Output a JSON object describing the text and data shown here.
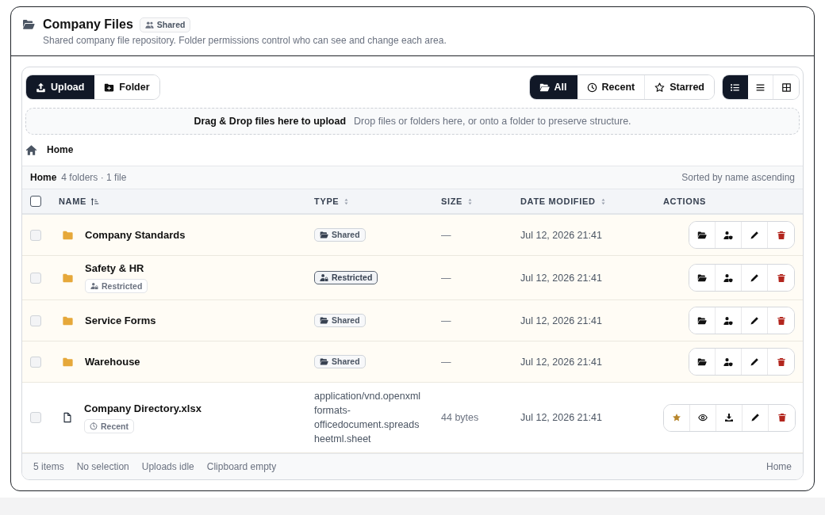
{
  "header": {
    "title": "Company Files",
    "badge": "Shared",
    "description": "Shared company file repository. Folder permissions control who can see and change each area."
  },
  "toolbar": {
    "actions": [
      {
        "kind": "upload",
        "label": "Upload",
        "primary": true
      },
      {
        "kind": "folder",
        "label": "Folder",
        "primary": false
      }
    ],
    "filters": [
      {
        "label": "All",
        "selected": true
      },
      {
        "label": "Recent",
        "selected": false
      },
      {
        "label": "Starred",
        "selected": false
      }
    ],
    "views": [
      {
        "kind": "details",
        "selected": true
      },
      {
        "kind": "list",
        "selected": false
      },
      {
        "kind": "grid",
        "selected": false
      }
    ]
  },
  "dropzone": {
    "title": "Drag & Drop files here to upload",
    "hint": "Drop files or folders here, or onto a folder to preserve structure."
  },
  "breadcrumb": [
    {
      "label": "Home"
    }
  ],
  "summary": {
    "location": "Home",
    "counts": "4 folders · 1 file",
    "sort_note": "Sorted by name ascending"
  },
  "table": {
    "select_all": false,
    "columns": [
      {
        "label": "NAME",
        "sorted": true
      },
      {
        "label": "TYPE",
        "sorted": false
      },
      {
        "label": "SIZE",
        "sorted": false
      },
      {
        "label": "DATE MODIFIED",
        "sorted": false
      },
      {
        "label": "ACTIONS"
      }
    ],
    "rows": [
      {
        "kind": "folder",
        "selected": false,
        "name": "Company Standards",
        "type": {
          "kind": "shared",
          "label": "Shared"
        },
        "size": "—",
        "modified": "Jul 12, 2026 21:41",
        "actions": [
          {
            "kind": "open"
          },
          {
            "kind": "permissions"
          },
          {
            "kind": "rename"
          },
          {
            "kind": "delete"
          }
        ]
      },
      {
        "kind": "folder",
        "selected": false,
        "name": "Safety & HR",
        "tag": {
          "kind": "restricted",
          "label": "Restricted"
        },
        "type": {
          "kind": "restricted",
          "label": "Restricted"
        },
        "size": "—",
        "modified": "Jul 12, 2026 21:41",
        "actions": [
          {
            "kind": "open"
          },
          {
            "kind": "permissions"
          },
          {
            "kind": "rename"
          },
          {
            "kind": "delete"
          }
        ]
      },
      {
        "kind": "folder",
        "selected": false,
        "name": "Service Forms",
        "type": {
          "kind": "shared",
          "label": "Shared"
        },
        "size": "—",
        "modified": "Jul 12, 2026 21:41",
        "actions": [
          {
            "kind": "open"
          },
          {
            "kind": "permissions"
          },
          {
            "kind": "rename"
          },
          {
            "kind": "delete"
          }
        ]
      },
      {
        "kind": "folder",
        "selected": false,
        "name": "Warehouse",
        "type": {
          "kind": "shared",
          "label": "Shared"
        },
        "size": "—",
        "modified": "Jul 12, 2026 21:41",
        "actions": [
          {
            "kind": "open"
          },
          {
            "kind": "permissions"
          },
          {
            "kind": "rename"
          },
          {
            "kind": "delete"
          }
        ]
      },
      {
        "kind": "file",
        "selected": false,
        "name": "Company Directory.xlsx",
        "tag": {
          "kind": "recent",
          "label": "Recent"
        },
        "type": {
          "kind": "text",
          "label": "application/vnd.openxmlformats-officedocument.spreadsheetml.sheet"
        },
        "size": "44 bytes",
        "modified": "Jul 12, 2026 21:41",
        "actions": [
          {
            "kind": "star",
            "on": true
          },
          {
            "kind": "preview"
          },
          {
            "kind": "download"
          },
          {
            "kind": "rename"
          },
          {
            "kind": "delete"
          }
        ]
      }
    ]
  },
  "status_bar": {
    "items": [
      "5 items",
      "No selection",
      "Uploads idle",
      "Clipboard empty"
    ],
    "location": "Home"
  }
}
